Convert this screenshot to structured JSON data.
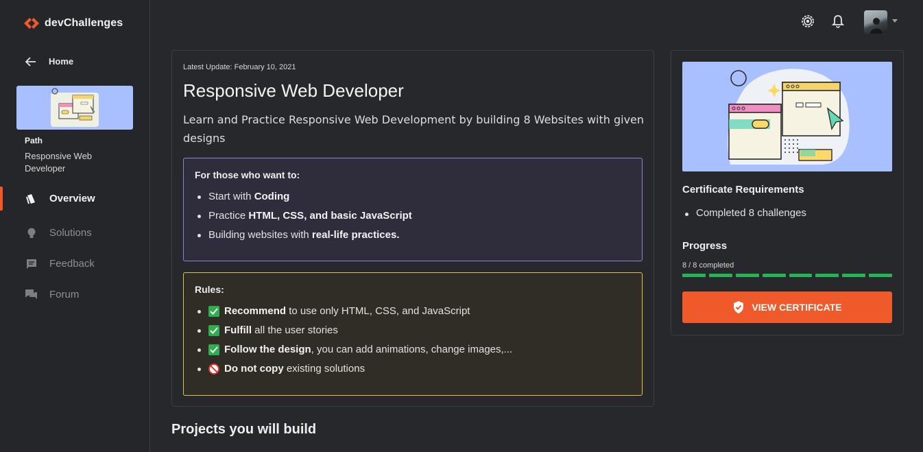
{
  "brand": {
    "name": "devChallenges"
  },
  "sidebar": {
    "home_label": "Home",
    "path_kicker": "Path",
    "path_name": "Responsive Web Developer",
    "items": [
      {
        "label": "Overview",
        "icon": "overview-icon",
        "active": true
      },
      {
        "label": "Solutions",
        "icon": "lightbulb-icon",
        "active": false
      },
      {
        "label": "Feedback",
        "icon": "feedback-icon",
        "active": false
      },
      {
        "label": "Forum",
        "icon": "forum-icon",
        "active": false
      }
    ]
  },
  "topbar": {
    "icons": [
      "settings-icon",
      "bell-icon"
    ],
    "avatar": "user-avatar"
  },
  "main": {
    "update": "Latest Update: February 10, 2021",
    "title": "Responsive Web Developer",
    "subtitle": "Learn and Practice Responsive Web Development by building 8 Websites with given designs",
    "for_box": {
      "title": "For those who want to:",
      "items": [
        {
          "pre": "Start with ",
          "bold": "Coding",
          "post": ""
        },
        {
          "pre": "Practice ",
          "bold": "HTML, CSS, and basic JavaScript",
          "post": ""
        },
        {
          "pre": "Building websites with ",
          "bold": "real-life practices.",
          "post": ""
        }
      ]
    },
    "rules_box": {
      "title": "Rules:",
      "items": [
        {
          "bold": "Recommend",
          "post": " to use only HTML, CSS, and JavaScript",
          "icon": "check-icon"
        },
        {
          "bold": "Fulfill",
          "post": " all the user stories",
          "icon": "check-icon"
        },
        {
          "bold": "Follow the design",
          "post": ", you can add animations, change images,...",
          "icon": "check-icon"
        },
        {
          "bold": "Do not copy",
          "post": " existing solutions",
          "icon": "no-entry-icon"
        }
      ]
    },
    "projects_heading": "Projects you will build"
  },
  "certificate": {
    "req_title": "Certificate Requirements",
    "req_items": [
      "Completed 8 challenges"
    ],
    "progress_title": "Progress",
    "progress_text": "8 / 8 completed",
    "progress_completed": 8,
    "progress_total": 8,
    "button_label": "VIEW CERTIFICATE"
  },
  "colors": {
    "accent": "#f05a2a",
    "progress": "#24b357",
    "purple_border": "#8e83d6",
    "yellow_border": "#e3c44b",
    "illustration_bg": "#a8c0ff"
  }
}
